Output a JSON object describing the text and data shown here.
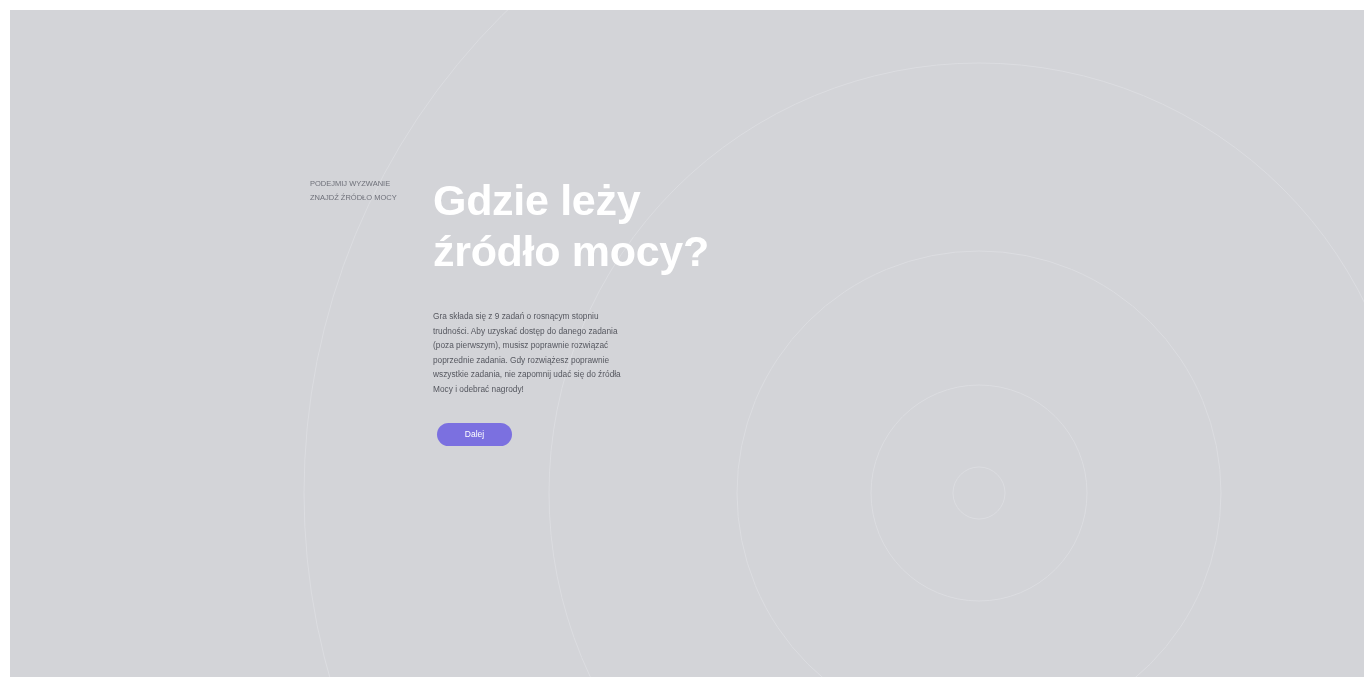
{
  "eyebrow": [
    "PODEJMIJ WYZWANIE",
    "ZNAJDŹ ŹRÓDŁO MOCY"
  ],
  "heading": [
    "Gdzie leży",
    "źródło mocy?"
  ],
  "description": "Gra składa się z 9 zadań o rosnącym stopniu trudności. Aby uzyskać dostęp do danego zadania (poza pierwszym), musisz poprawnie rozwiązać poprzednie zadania. Gdy rozwiążesz poprawnie wszystkie zadania, nie zapomnij udać się do źródła Mocy i odebrać nagrody!",
  "button": {
    "label": "Dalej"
  }
}
